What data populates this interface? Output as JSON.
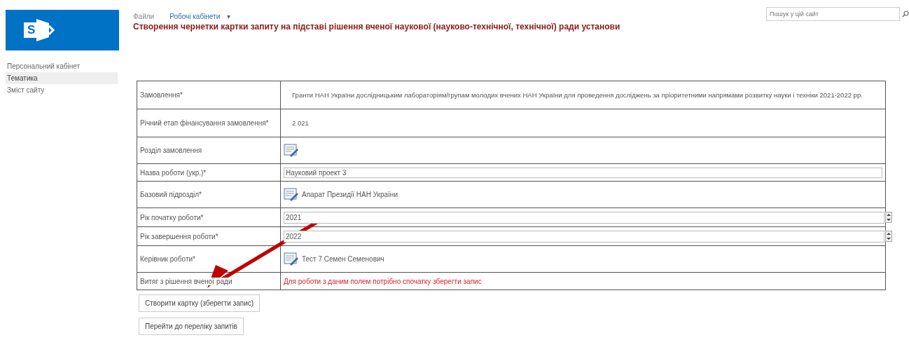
{
  "breadcrumb": {
    "items": [
      {
        "label": "Файли",
        "selected": false
      },
      {
        "label": "Робочі кабінети",
        "selected": true
      }
    ],
    "menu_glyph": "▾"
  },
  "page_title": "Створення чернетки картки запиту на підставі рішення вченої наукової (науково-технічної, технічної) ради установи",
  "logo": {
    "letter": "S"
  },
  "search": {
    "placeholder": "Пошук у цій сайт"
  },
  "sidebar": {
    "items": [
      {
        "label": "Персональний кабінет",
        "selected": false
      },
      {
        "label": "Тематика",
        "selected": true
      },
      {
        "label": "Зміст сайту",
        "selected": false
      }
    ]
  },
  "form": {
    "rows": [
      {
        "label": "Замовлення*",
        "kind": "text",
        "value": "Гранти НАН України дослідницьким лабораторіям/групам молодих вчених НАН України для проведення досліджень за пріоритетними напрямами розвитку науки і техніки 2021-2022 рр."
      },
      {
        "label": "Річний етап фінансування замовлення*",
        "kind": "text",
        "value": "2 021"
      },
      {
        "label": "Розділ замовлення",
        "kind": "picker"
      },
      {
        "label": "Назва роботи (укр.)*",
        "kind": "input",
        "value": "Науковий проект 3"
      },
      {
        "label": "Базовий підрозділ*",
        "kind": "picker",
        "value": "Апарат Президії НАН України"
      },
      {
        "label": "Рік початку роботи*",
        "kind": "spinner",
        "value": "2021"
      },
      {
        "label": "Рік завершення роботи*",
        "kind": "spinner",
        "value": "2022"
      },
      {
        "label": "Керівник роботи*",
        "kind": "picker",
        "value": "Тест 7 Семен Семенович"
      },
      {
        "label": "Витяг з рішення вченої ради",
        "kind": "message",
        "value": "Для роботи з даним полем потрібно спочатку зберегти запис"
      }
    ]
  },
  "buttons": [
    "Створити картку (зберегти запис)",
    "Перейти до переліку запитів"
  ]
}
